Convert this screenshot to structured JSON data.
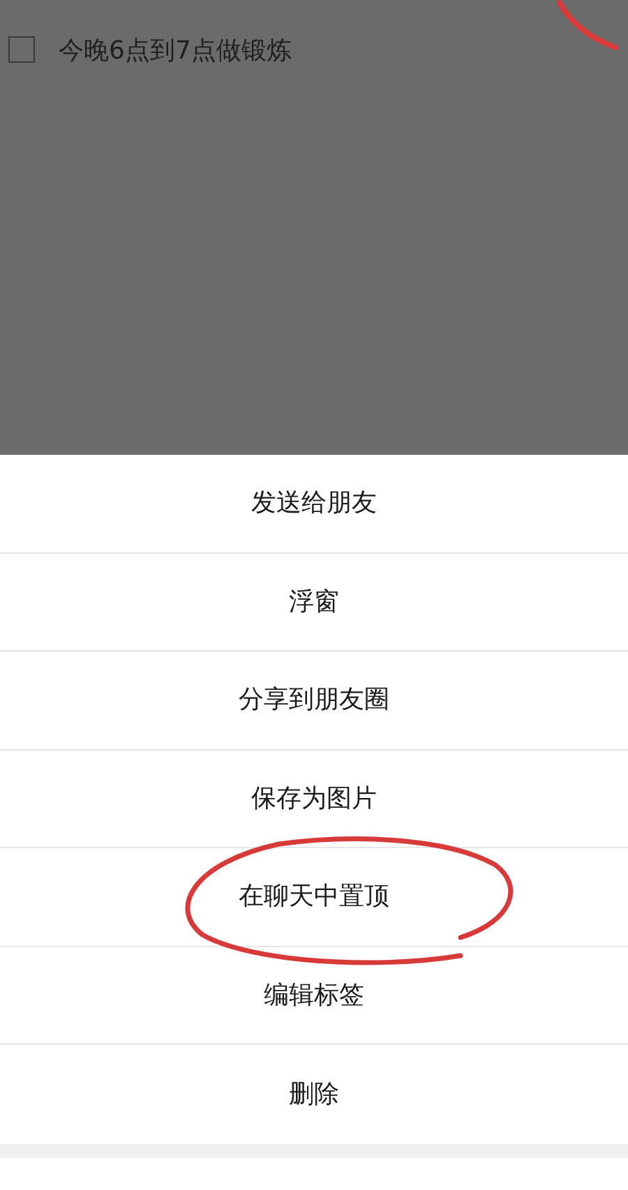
{
  "task": {
    "text": "今晚6点到7点做锻炼",
    "checked": false
  },
  "action_sheet": {
    "items": [
      {
        "label": "发送给朋友"
      },
      {
        "label": "浮窗"
      },
      {
        "label": "分享到朋友圈"
      },
      {
        "label": "保存为图片"
      },
      {
        "label": "在聊天中置顶"
      },
      {
        "label": "编辑标签"
      },
      {
        "label": "删除"
      }
    ]
  }
}
